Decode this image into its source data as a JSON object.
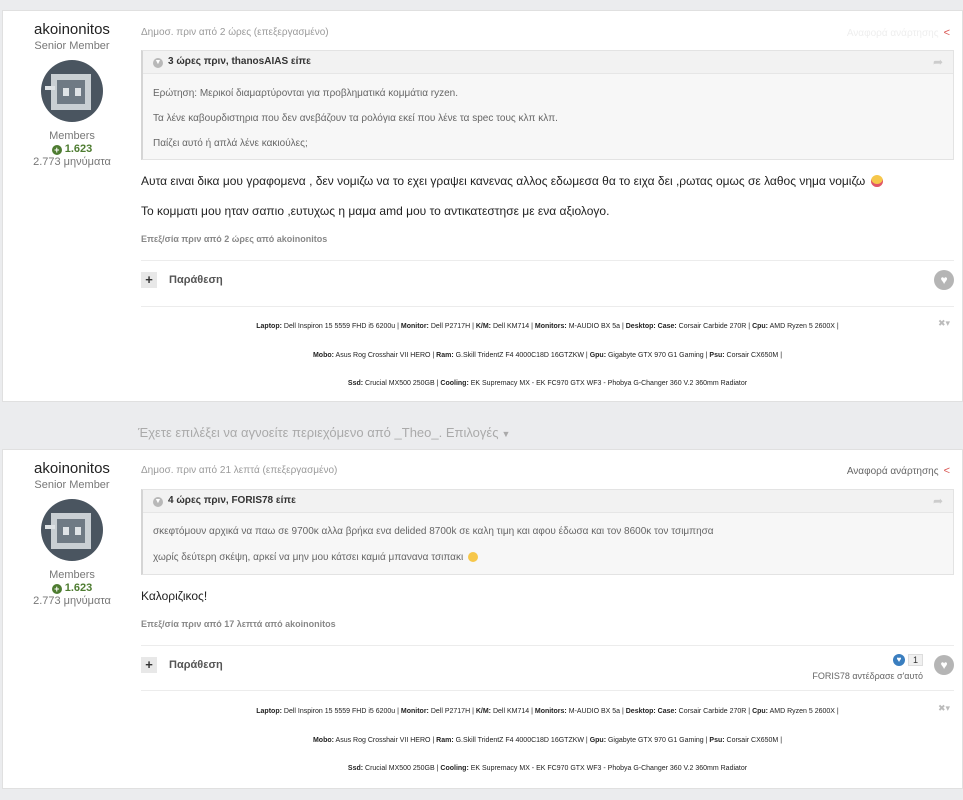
{
  "post1": {
    "author": {
      "name": "akoinonitos",
      "rank": "Senior Member",
      "group": "Members",
      "reputation": "1.623",
      "post_count": "2.773 μηνύματα"
    },
    "meta": "Δημοσ. πριν από 2 ώρες (επεξεργασμένο)",
    "report_label": "Αναφορά ανάρτησης",
    "quote": {
      "header": "3 ώρες πριν, thanosAIAS είπε",
      "lines": [
        "Ερώτηση:   Μερικοί διαμαρτύρονται για προβληματικά κομμάτια ryzen.",
        "Τα λένε καβουρδιστηρια που δεν ανεβάζουν τα ρολόγια εκεί που λένε τα spec τους κλπ κλπ.",
        "Παίζει αυτό ή απλά λένε κακιούλες;"
      ]
    },
    "body": [
      "Αυτα ειναι δικα μου γραφομενα , δεν νομιζω να το εχει γραψει κανενας αλλος εδωμεσα θα το ειχα δει ,ρωτας ομως  σε λαθος νημα νομιζω",
      "Το κομματι μου ηταν  σαπιο ,ευτυχως η μαμα amd μου το αντικατεστησε με ενα αξιολογο."
    ],
    "edited": "Επεξ/σία πριν από 2 ώρες από akoinonitos",
    "quote_button": "Παράθεση"
  },
  "ignored_notice": "Έχετε επιλέξει να αγνοείτε περιεχόμενο από _Theo_. Επιλογές",
  "post2": {
    "author": {
      "name": "akoinonitos",
      "rank": "Senior Member",
      "group": "Members",
      "reputation": "1.623",
      "post_count": "2.773 μηνύματα"
    },
    "meta": "Δημοσ. πριν από 21 λεπτά (επεξεργασμένο)",
    "report_label": "Αναφορά ανάρτησης",
    "quote": {
      "header": "4 ώρες πριν, FORIS78 είπε",
      "lines": [
        "σκεφτόμουν αρχικά να παω σε 9700κ αλλα βρήκα ενα delided 8700k σε  καλη τιμη και αφου έδωσα και τον 8600κ τον τσιμπησα",
        "χωρίς δεύτερη σκέψη, αρκεί να μην μου κάτσει καμιά μπανανα τσιπακι"
      ]
    },
    "body": [
      "Καλοριζικος!"
    ],
    "edited": "Επεξ/σία πριν από 17 λεπτά από akoinonitos",
    "quote_button": "Παράθεση",
    "reaction_count": "1",
    "reaction_by": "FORIS78 αντέδρασε σ'αυτό"
  },
  "signature": {
    "line1": [
      {
        "k": "Laptop:",
        "v": " Dell Inspiron 15 5559 FHD i5 6200u | "
      },
      {
        "k": "Monitor:",
        "v": " Dell P2717H | "
      },
      {
        "k": "K/M:",
        "v": " Dell KM714 | "
      },
      {
        "k": "Monitors:",
        "v": " M-AUDIO BX 5a | "
      },
      {
        "k": "Desktop: Case:",
        "v": " Corsair Carbide 270R | "
      },
      {
        "k": "Cpu:",
        "v": " AMD Ryzen 5 2600X |"
      }
    ],
    "line2": [
      {
        "k": "Mobo:",
        "v": " Asus Rog Crosshair VII HERO | "
      },
      {
        "k": "Ram:",
        "v": " G.Skill TridentZ F4 4000C18D 16GTZKW | "
      },
      {
        "k": "Gpu:",
        "v": " Gigabyte GTX 970 G1 Gaming | "
      },
      {
        "k": "Psu:",
        "v": " Corsair CX650M |"
      }
    ],
    "line3": [
      {
        "k": "Ssd:",
        "v": " Crucial MX500 250GB | "
      },
      {
        "k": "Cooling:",
        "v": " EK Supremacy MX - EK FC970 GTX WF3 - Phobya G-Changer 360 V.2 360mm Radiator"
      }
    ]
  }
}
